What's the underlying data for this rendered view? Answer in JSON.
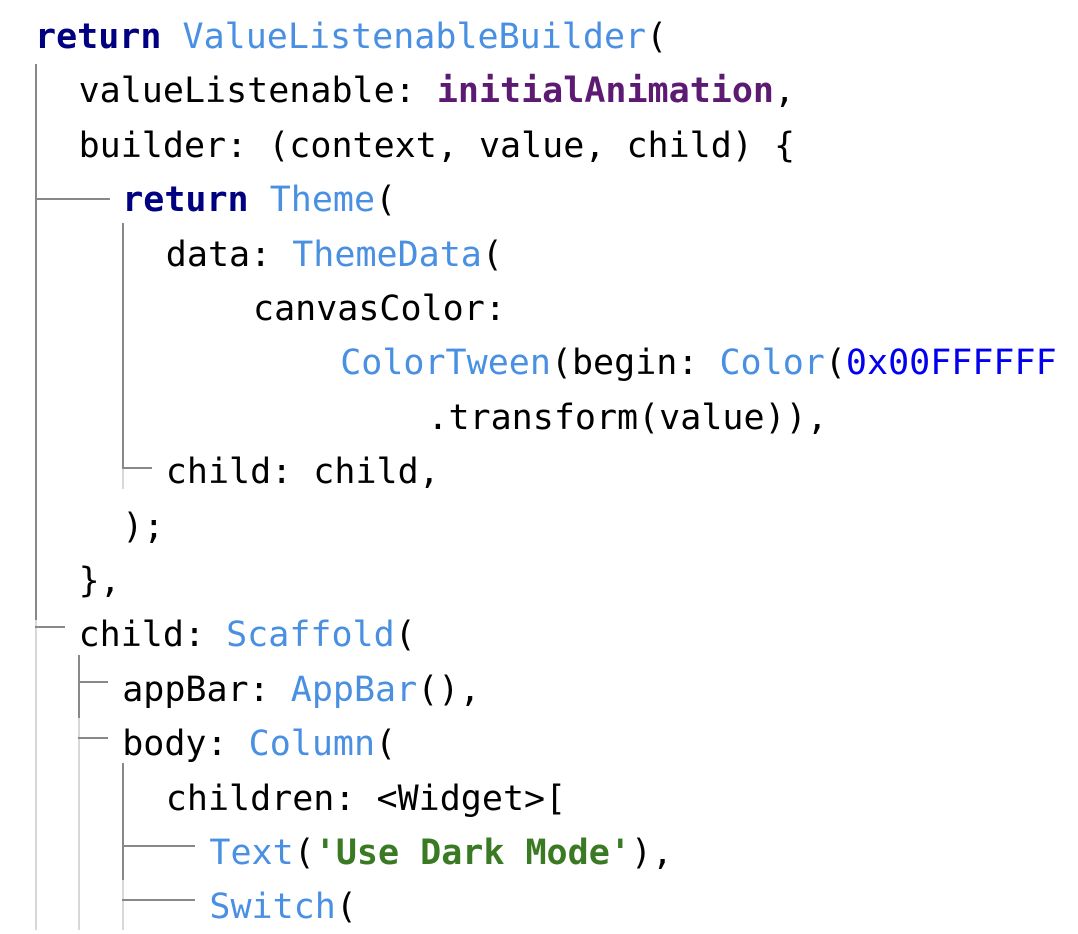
{
  "editor": {
    "language": "Dart",
    "lines": [
      {
        "tokens": [
          {
            "t": "kw",
            "v": "return"
          },
          {
            "t": "plain",
            "v": " "
          },
          {
            "t": "type",
            "v": "ValueListenableBuilder"
          },
          {
            "t": "plain",
            "v": "("
          }
        ]
      },
      {
        "tokens": [
          {
            "t": "plain",
            "v": "valueListenable: "
          },
          {
            "t": "field",
            "v": "initialAnimation"
          },
          {
            "t": "plain",
            "v": ","
          }
        ]
      },
      {
        "tokens": [
          {
            "t": "plain",
            "v": "builder: (context, value, child) {"
          }
        ]
      },
      {
        "tokens": [
          {
            "t": "kw",
            "v": "return"
          },
          {
            "t": "plain",
            "v": " "
          },
          {
            "t": "type",
            "v": "Theme"
          },
          {
            "t": "plain",
            "v": "("
          }
        ]
      },
      {
        "tokens": [
          {
            "t": "plain",
            "v": "data: "
          },
          {
            "t": "type",
            "v": "ThemeData"
          },
          {
            "t": "plain",
            "v": "("
          }
        ]
      },
      {
        "tokens": [
          {
            "t": "plain",
            "v": "canvasColor:"
          }
        ]
      },
      {
        "tokens": [
          {
            "t": "type",
            "v": "ColorTween"
          },
          {
            "t": "plain",
            "v": "(begin: "
          },
          {
            "t": "type",
            "v": "Color"
          },
          {
            "t": "plain",
            "v": "("
          },
          {
            "t": "num",
            "v": "0x00FFFFFF"
          }
        ]
      },
      {
        "tokens": [
          {
            "t": "plain",
            "v": ".transform(value)),"
          }
        ]
      },
      {
        "tokens": [
          {
            "t": "plain",
            "v": "child: child,"
          }
        ]
      },
      {
        "tokens": [
          {
            "t": "plain",
            "v": ");"
          }
        ]
      },
      {
        "tokens": [
          {
            "t": "plain",
            "v": "},"
          }
        ]
      },
      {
        "tokens": [
          {
            "t": "plain",
            "v": "child: "
          },
          {
            "t": "type",
            "v": "Scaffold"
          },
          {
            "t": "plain",
            "v": "("
          }
        ]
      },
      {
        "tokens": [
          {
            "t": "plain",
            "v": "appBar: "
          },
          {
            "t": "type",
            "v": "AppBar"
          },
          {
            "t": "plain",
            "v": "(),"
          }
        ]
      },
      {
        "tokens": [
          {
            "t": "plain",
            "v": "body: "
          },
          {
            "t": "type",
            "v": "Column"
          },
          {
            "t": "plain",
            "v": "("
          }
        ]
      },
      {
        "tokens": [
          {
            "t": "plain",
            "v": "children: <Widget>["
          }
        ]
      },
      {
        "tokens": [
          {
            "t": "type",
            "v": "Text"
          },
          {
            "t": "plain",
            "v": "("
          },
          {
            "t": "str",
            "v": "'Use Dark Mode'"
          },
          {
            "t": "plain",
            "v": "),"
          }
        ]
      },
      {
        "tokens": [
          {
            "t": "type",
            "v": "Switch"
          },
          {
            "t": "plain",
            "v": "("
          }
        ]
      }
    ]
  }
}
